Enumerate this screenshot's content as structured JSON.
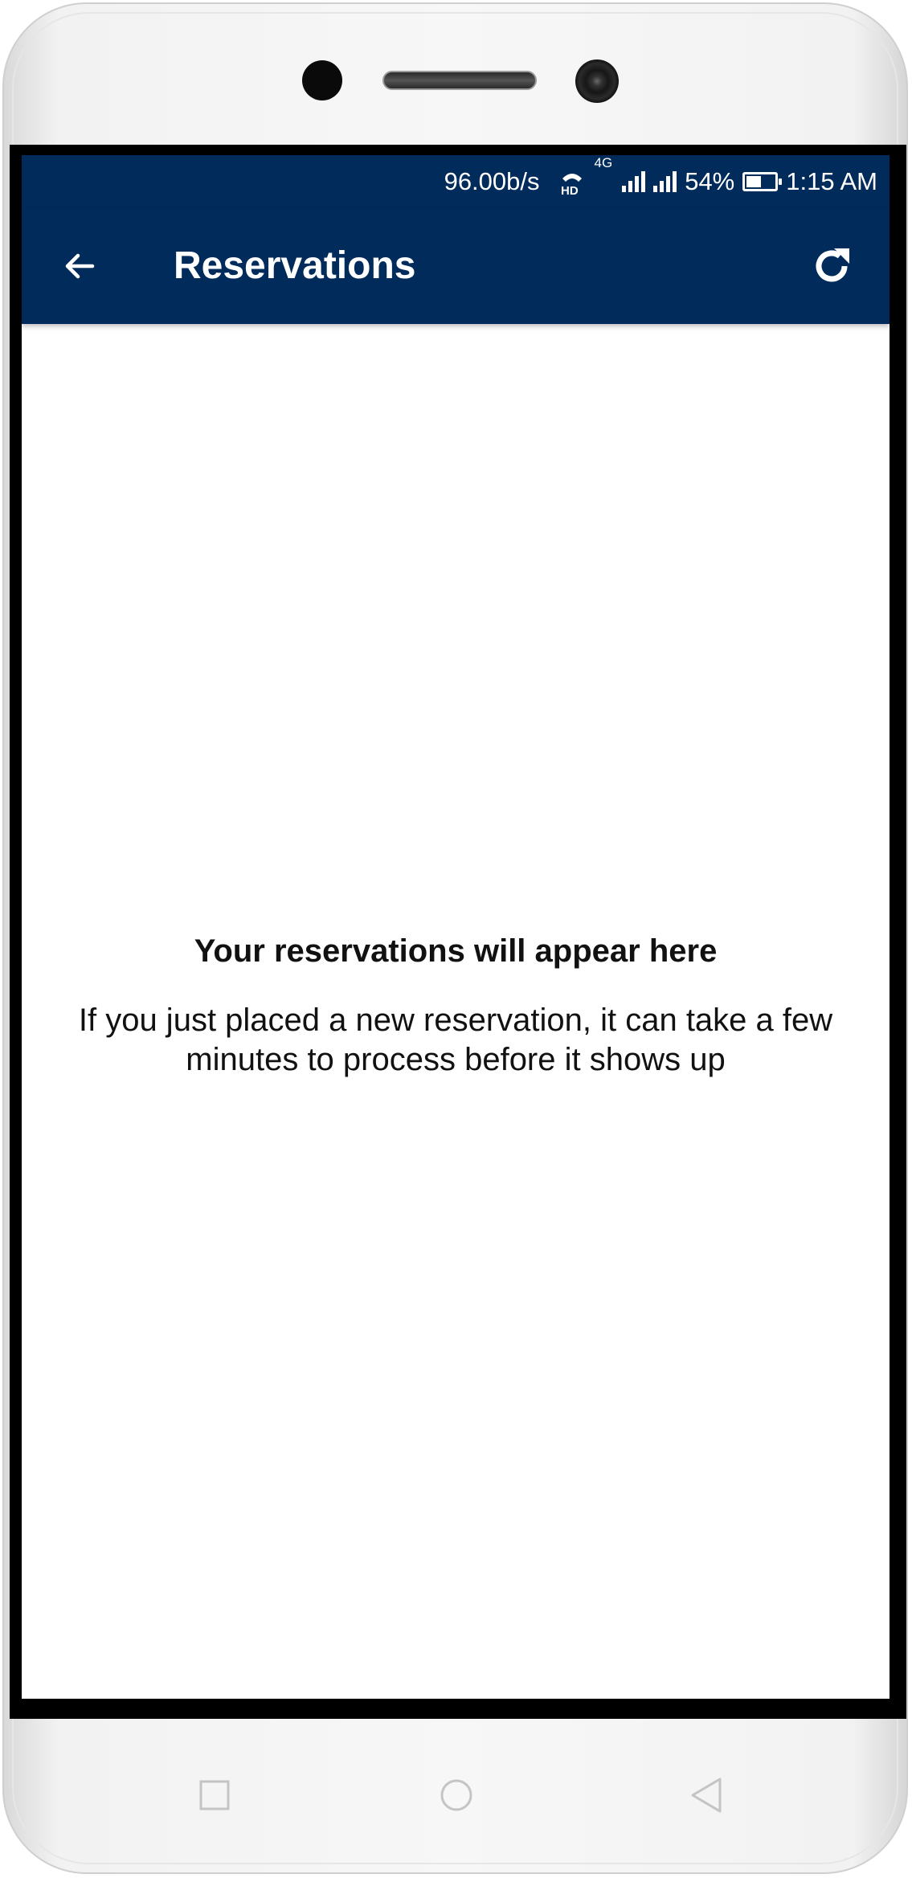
{
  "status_bar": {
    "network_speed": "96.00b/s",
    "network_type": "4G",
    "battery_percent": "54%",
    "battery_level": 0.54,
    "time": "1:15 AM"
  },
  "app_bar": {
    "title": "Reservations",
    "background_color": "#012b5b",
    "back_icon": "arrow-left-icon",
    "refresh_icon": "refresh-icon"
  },
  "empty_state": {
    "title": "Your reservations will appear here",
    "message": "If you just placed a new reservation, it can take a few minutes to process before it shows up"
  },
  "navigation_bar": {
    "recent_icon": "square-icon",
    "home_icon": "circle-icon",
    "back_icon": "triangle-back-icon"
  }
}
